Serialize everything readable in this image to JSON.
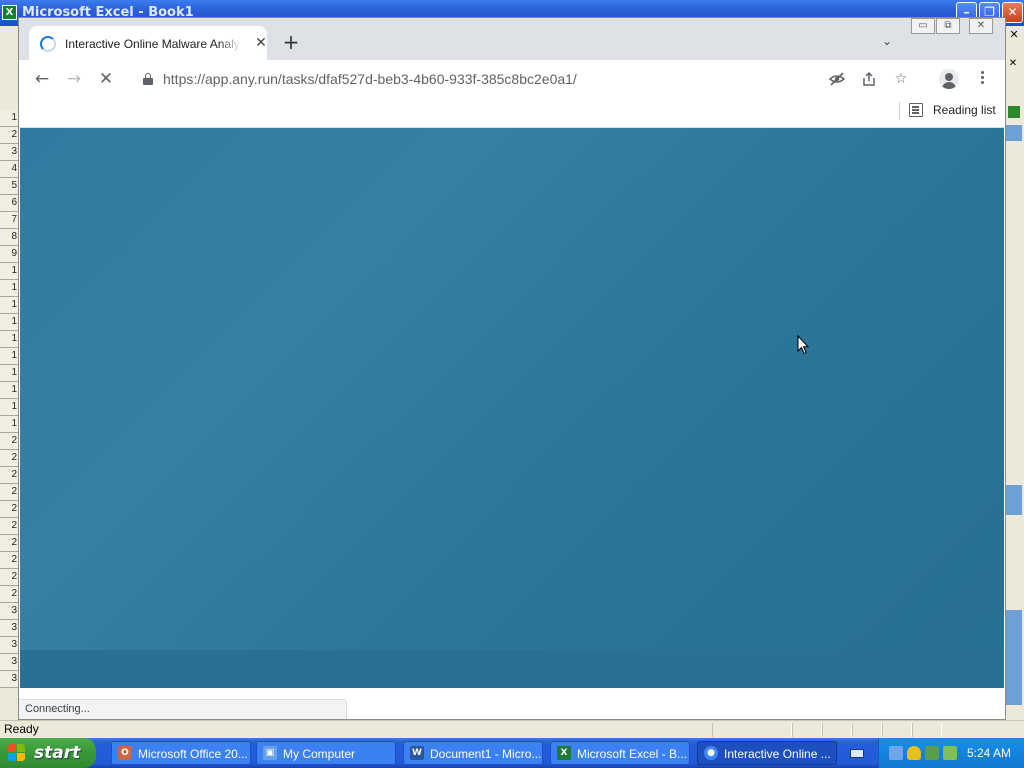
{
  "excel": {
    "title": "Microsoft Excel - Book1",
    "status_text": "Ready",
    "row_headers": [
      "1",
      "2",
      "3",
      "4",
      "5",
      "6",
      "7",
      "8",
      "9",
      "1",
      "1",
      "1",
      "1",
      "1",
      "1",
      "1",
      "1",
      "1",
      "1",
      "2",
      "2",
      "2",
      "2",
      "2",
      "2",
      "2",
      "2",
      "2",
      "2",
      "3",
      "3",
      "3",
      "3",
      "3"
    ]
  },
  "chrome": {
    "tab_title": "Interactive Online Malware Analysis",
    "url": "https://app.any.run/tasks/dfaf527d-beb3-4b60-933f-385c8bc2e0a1/",
    "reading_list_label": "Reading list",
    "status_bubble": "Connecting...",
    "page_state": "loading"
  },
  "taskbar": {
    "start_label": "start",
    "tasks": [
      {
        "label": "Microsoft Office 20...",
        "icon": "office-icon",
        "active": false
      },
      {
        "label": "My Computer",
        "icon": "computer-icon",
        "active": false
      },
      {
        "label": "Document1 - Micro...",
        "icon": "word-icon",
        "active": false
      },
      {
        "label": "Microsoft Excel - B...",
        "icon": "excel-icon",
        "active": false
      },
      {
        "label": "Interactive Online ...",
        "icon": "chrome-icon",
        "active": true
      }
    ],
    "clock": "5:24 AM"
  },
  "colors": {
    "content_bg": "#2f7ca0",
    "xp_taskbar": "#245edb",
    "start_green": "#3a9c3a",
    "chrome_accent": "#1a73e8"
  }
}
